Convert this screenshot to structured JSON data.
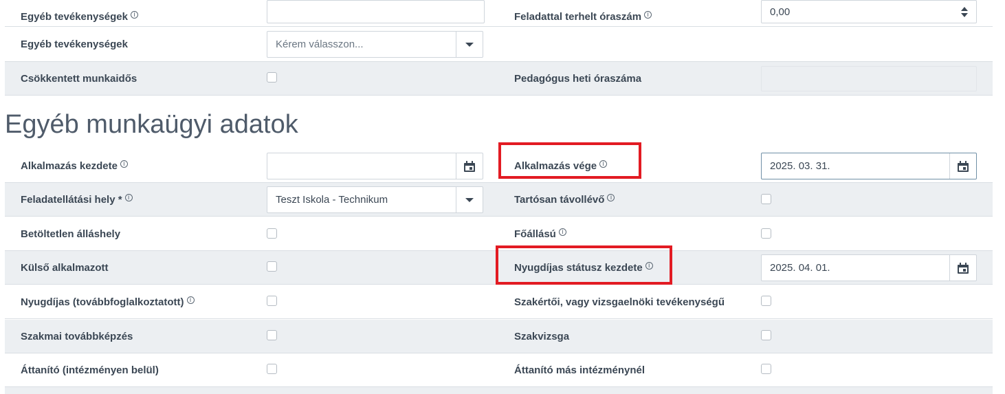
{
  "top_rows": [
    {
      "left_label": "Egyéb tevékenységek",
      "left_info": true,
      "left_value": "",
      "right_label": "Feladattal terhelt óraszám",
      "right_info": true,
      "right_value": "0,00"
    },
    {
      "left_label": "Egyéb tevékenységek",
      "left_info": false,
      "left_select_placeholder": "Kérem válasszon..."
    },
    {
      "left_label": "Csökkentett munkaidős",
      "left_info": false,
      "right_label": "Pedagógus heti óraszáma",
      "right_info": false,
      "right_value": ""
    }
  ],
  "section": {
    "title": "Egyéb munkaügyi adatok"
  },
  "rows": [
    {
      "left_label": "Alkalmazás kezdete",
      "left_value": "",
      "right_label": "Alkalmazás vége",
      "right_value": "2025. 03. 31."
    },
    {
      "left_label": "Feladatellátási hely *",
      "left_value": "Teszt Iskola - Technikum",
      "right_label": "Tartósan távollévő"
    },
    {
      "left_label": "Betöltetlen álláshely",
      "right_label": "Főállású"
    },
    {
      "left_label": "Külső alkalmazott",
      "right_label": "Nyugdíjas státusz kezdete",
      "right_value": "2025. 04. 01."
    },
    {
      "left_label": "Nyugdíjas (továbbfoglalkoztatott)",
      "right_label": "Szakértői, vagy vizsgaelnöki tevékenységű"
    },
    {
      "left_label": "Szakmai továbbképzés",
      "right_label": "Szakvizsga"
    },
    {
      "left_label": "Áttanító (intézményen belül)",
      "right_label": "Áttanító más intézménynél"
    }
  ],
  "info_symbol": "i",
  "colors": {
    "highlight": "#e21b23",
    "row_gray": "#eceff2",
    "label": "#3b4754"
  },
  "icons": [
    "calendar-icon",
    "chevron-down-icon",
    "spinner-icon",
    "info-icon"
  ]
}
